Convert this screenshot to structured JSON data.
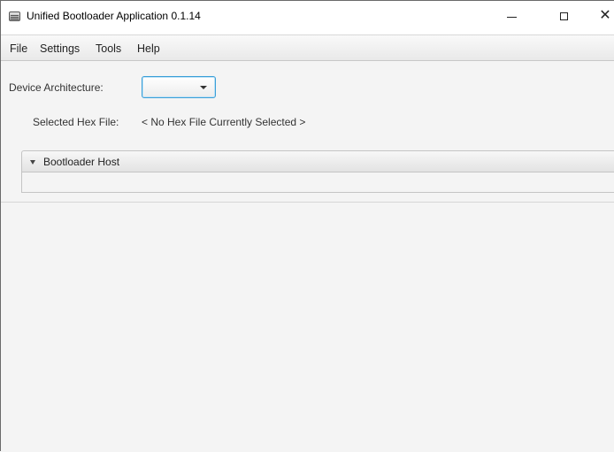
{
  "window": {
    "title": "Unified Bootloader Application 0.1.14",
    "minimize_glyph": "minimize",
    "maximize_glyph": "maximize",
    "close_glyph": "✕"
  },
  "menu": {
    "items": [
      {
        "label": "File"
      },
      {
        "label": "Settings"
      },
      {
        "label": "Tools"
      },
      {
        "label": "Help"
      }
    ]
  },
  "form": {
    "device_architecture_label": "Device Architecture:",
    "device_architecture_value": "",
    "selected_hex_label": "Selected Hex File:",
    "selected_hex_value": "< No Hex File Currently Selected >"
  },
  "bootloader_pane": {
    "title": "Bootloader Host",
    "expanded": true
  },
  "colors": {
    "focus_accent": "#3a9fd8",
    "background": "#f4f4f4"
  }
}
